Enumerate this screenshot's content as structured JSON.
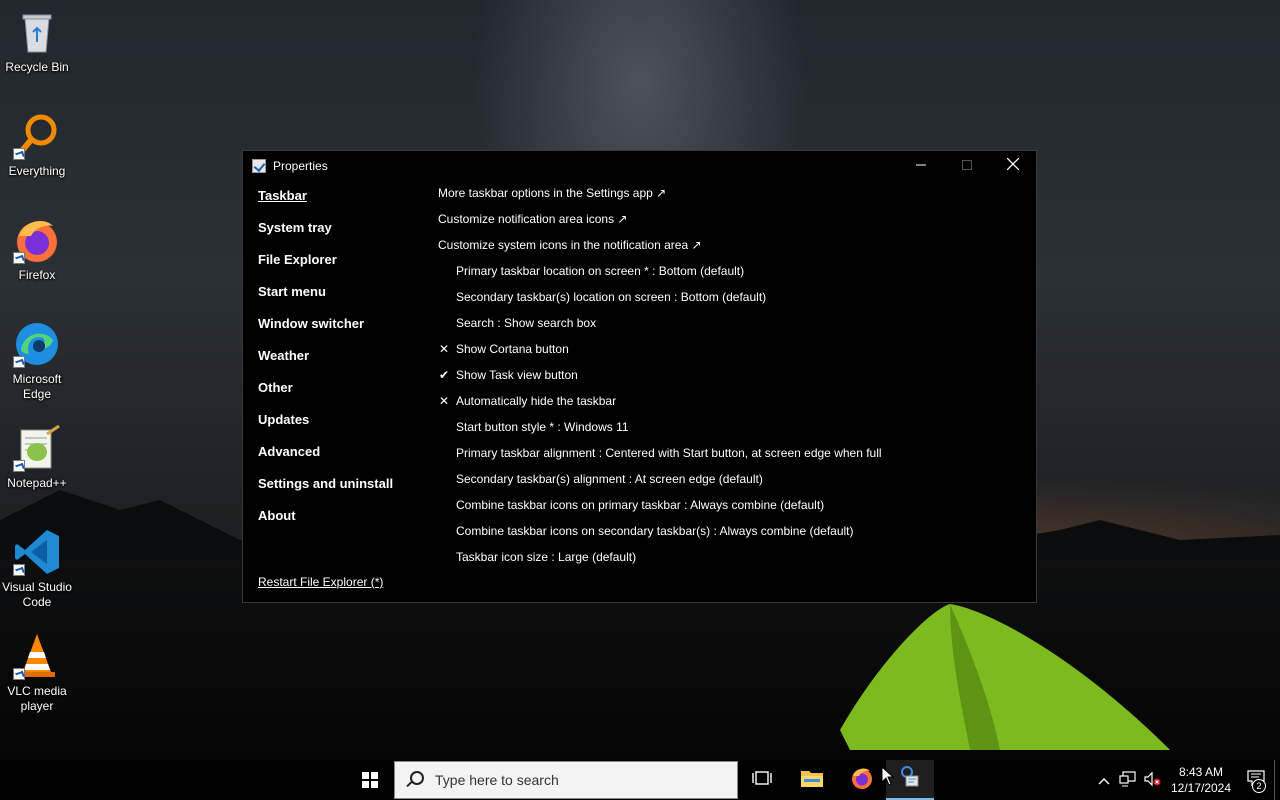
{
  "desktop": {
    "icons": [
      {
        "label": "Recycle Bin",
        "icon": "recycle-bin-icon"
      },
      {
        "label": "Everything",
        "icon": "everything-search-icon"
      },
      {
        "label": "Firefox",
        "icon": "firefox-icon"
      },
      {
        "label": "Microsoft Edge",
        "icon": "edge-icon"
      },
      {
        "label": "Notepad++",
        "icon": "notepad-plus-plus-icon"
      },
      {
        "label": "Visual Studio Code",
        "icon": "vscode-icon"
      },
      {
        "label": "VLC media player",
        "icon": "vlc-icon"
      }
    ]
  },
  "window": {
    "title": "Properties",
    "controls": {
      "minimize": "—",
      "maximize": "☐",
      "close": "✕"
    },
    "nav": [
      {
        "label": "Taskbar",
        "active": true
      },
      {
        "label": "System tray"
      },
      {
        "label": "File Explorer"
      },
      {
        "label": "Start menu"
      },
      {
        "label": "Window switcher"
      },
      {
        "label": "Weather"
      },
      {
        "label": "Other"
      },
      {
        "label": "Updates"
      },
      {
        "label": "Advanced"
      },
      {
        "label": "Settings and uninstall"
      },
      {
        "label": "About"
      }
    ],
    "restart_link": "Restart File Explorer (*)",
    "options": [
      {
        "text": "More taskbar options in the Settings app ↗",
        "kind": "link",
        "mark": ""
      },
      {
        "text": "Customize notification area icons ↗",
        "kind": "link",
        "mark": ""
      },
      {
        "text": "Customize system icons in the notification area ↗",
        "kind": "link",
        "mark": ""
      },
      {
        "text": "Primary taskbar location on screen * : Bottom (default)",
        "kind": "setting",
        "mark": ""
      },
      {
        "text": "Secondary taskbar(s) location on screen : Bottom (default)",
        "kind": "setting",
        "mark": ""
      },
      {
        "text": "Search : Show search box",
        "kind": "setting",
        "mark": ""
      },
      {
        "text": "Show Cortana button",
        "kind": "setting",
        "mark": "✕"
      },
      {
        "text": "Show Task view button",
        "kind": "setting",
        "mark": "✔"
      },
      {
        "text": "Automatically hide the taskbar",
        "kind": "setting",
        "mark": "✕"
      },
      {
        "text": "Start button style * : Windows 11",
        "kind": "setting",
        "mark": ""
      },
      {
        "text": "Primary taskbar alignment : Centered with Start button, at screen edge when full",
        "kind": "setting",
        "mark": ""
      },
      {
        "text": "Secondary taskbar(s) alignment : At screen edge (default)",
        "kind": "setting",
        "mark": ""
      },
      {
        "text": "Combine taskbar icons on primary taskbar : Always combine (default)",
        "kind": "setting",
        "mark": ""
      },
      {
        "text": "Combine taskbar icons on secondary taskbar(s) : Always combine (default)",
        "kind": "setting",
        "mark": ""
      },
      {
        "text": "Taskbar icon size : Large (default)",
        "kind": "setting",
        "mark": ""
      }
    ]
  },
  "taskbar": {
    "search_placeholder": "Type here to search",
    "pinned": [
      {
        "icon": "task-view-icon"
      },
      {
        "icon": "file-explorer-icon"
      },
      {
        "icon": "firefox-icon"
      },
      {
        "icon": "properties-app-icon",
        "active": true
      }
    ],
    "tray": {
      "time": "8:43 AM",
      "date": "12/17/2024",
      "notification_count": "2"
    }
  }
}
